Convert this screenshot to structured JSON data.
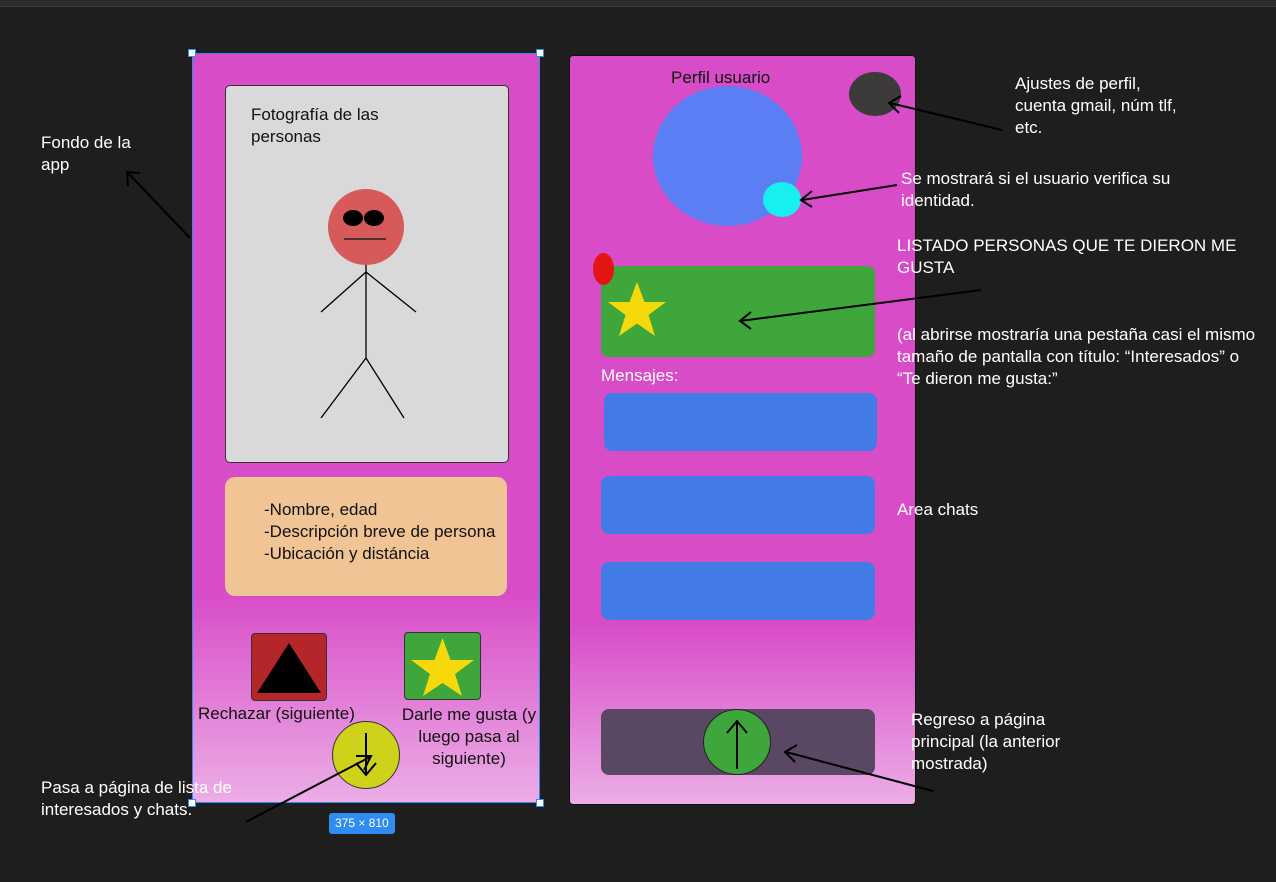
{
  "frame1": {
    "photo_label": "Fotografía de las personas",
    "info": {
      "line1": "-Nombre, edad",
      "line2": "-Descripción breve de persona",
      "line3": "-Ubicación y distáncia"
    },
    "reject_label": "Rechazar (siguiente)",
    "like_label": "Darle me gusta (y luego pasa al siguiente)",
    "size_badge": "375 × 810"
  },
  "frame2": {
    "title": "Perfil usuario",
    "messages_label": "Mensajes:"
  },
  "notes": {
    "background": "Fondo de la app",
    "next_page": "Pasa a página de lista de interesados y chats.",
    "settings": "Ajustes de perfil, cuenta gmail, núm tlf, etc.",
    "verify": "Se mostrará si el usuario verifica su identidad.",
    "likes_list": "LISTADO PERSONAS QUE TE DIERON ME GUSTA",
    "likes_detail": "(al abrirse mostraría una pestaña casi el mismo tamaño de pantalla con título: “Interesados” o “Te dieron me gusta:”",
    "chats": "Area chats",
    "return": "Regreso a página principal (la anterior mostrada)"
  },
  "colors": {
    "canvas": "#1e1e1e",
    "frame_bg": "#d84cc8",
    "selection": "#2f8cf0",
    "reject": "#b4262a",
    "like": "#3ea63a",
    "star": "#f5d90a",
    "down_button": "#cfd21a",
    "chat": "#437be6",
    "avatar": "#5b7ef5",
    "verify": "#18f0f0",
    "notification": "#e41414"
  },
  "icons": {
    "reject": "triangle-icon",
    "like": "star-icon",
    "next": "arrow-down-icon",
    "home": "arrow-up-icon"
  }
}
